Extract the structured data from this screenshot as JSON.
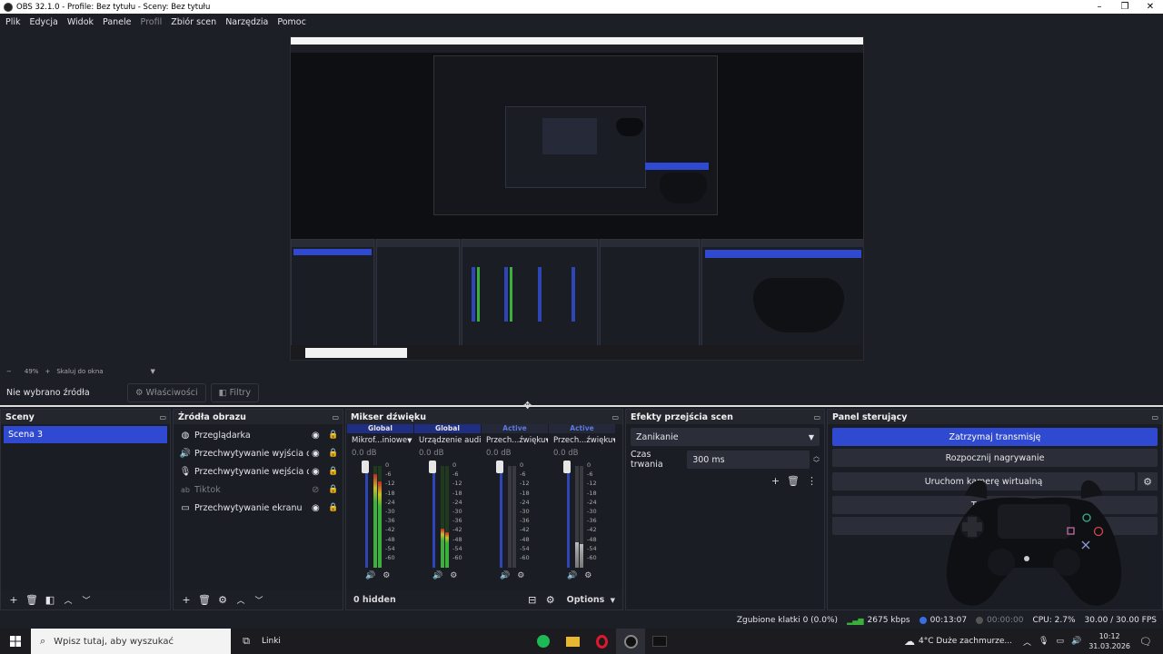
{
  "window": {
    "title": "OBS 32.1.0 - Profile: Bez tytułu - Sceny: Bez tytułu"
  },
  "menu": [
    {
      "label": "Plik",
      "enabled": true
    },
    {
      "label": "Edycja",
      "enabled": true
    },
    {
      "label": "Widok",
      "enabled": true
    },
    {
      "label": "Panele",
      "enabled": true
    },
    {
      "label": "Profil",
      "enabled": false
    },
    {
      "label": "Zbiór scen",
      "enabled": true
    },
    {
      "label": "Narzędzia",
      "enabled": true
    },
    {
      "label": "Pomoc",
      "enabled": true
    }
  ],
  "zoom": {
    "level": "49%",
    "mode": "Skaluj do okna"
  },
  "source_toolbar": {
    "no_source": "Nie wybrano źródła",
    "properties": "Właściwości",
    "filters": "Filtry"
  },
  "scenes": {
    "title": "Sceny",
    "items": [
      "Scena 3"
    ]
  },
  "sources": {
    "title": "Źródła obrazu",
    "items": [
      {
        "name": "Przeglądarka",
        "icon": "globe-icon",
        "visible": true
      },
      {
        "name": "Przechwytywanie wyjścia dźwięku",
        "icon": "speaker-icon",
        "visible": true
      },
      {
        "name": "Przechwytywanie wejścia dźwięku",
        "icon": "microphone-icon",
        "visible": true
      },
      {
        "name": "Tiktok",
        "icon": "text-icon",
        "visible": false
      },
      {
        "name": "Przechwytywanie ekranu",
        "icon": "monitor-icon",
        "visible": true
      }
    ]
  },
  "mixer": {
    "title": "Mikser dźwięku",
    "hidden_label": "0 hidden",
    "options_label": "Options",
    "scale": [
      "0",
      "-6",
      "-12",
      "-18",
      "-24",
      "-30",
      "-36",
      "-42",
      "-48",
      "-54",
      "-60"
    ],
    "channels": [
      {
        "status": "Global",
        "name": "Mikrof...iniowe",
        "db": "0.0 dB",
        "level": 0.92,
        "muted": false,
        "active": false
      },
      {
        "status": "Global",
        "name": "Urządzenie audio",
        "db": "0.0 dB",
        "level": 0.38,
        "muted": false,
        "active": false
      },
      {
        "status": "Active",
        "name": "Przech...źwięku",
        "db": "0.0 dB",
        "level": 0.0,
        "muted": true,
        "active": true
      },
      {
        "status": "Active",
        "name": "Przech...źwięku",
        "db": "0.0 dB",
        "level": 0.25,
        "muted": true,
        "active": true
      }
    ]
  },
  "transitions": {
    "title": "Efekty przejścia scen",
    "selected": "Zanikanie",
    "duration_label": "Czas trwania",
    "duration_value": "300 ms"
  },
  "controls": {
    "title": "Panel sterujący",
    "stop_stream": "Zatrzymaj transmisję",
    "start_record": "Rozpocznij nagrywanie",
    "virtual_cam": "Uruchom kamerę wirtualną",
    "studio_mode": "Tryb studia"
  },
  "status": {
    "dropped": "Zgubione klatki 0 (0.0%)",
    "bitrate": "2675 kbps",
    "stream_time": "00:13:07",
    "record_time": "00:00:00",
    "cpu": "CPU: 2.7%",
    "fps": "30.00 / 30.00 FPS"
  },
  "taskbar": {
    "search_placeholder": "Wpisz tutaj, aby wyszukać",
    "links": "Linki",
    "weather": "4°C  Duże zachmurze...",
    "time": "10:12",
    "date": "31.03.2026"
  },
  "colors": {
    "accent": "#2f4ad0",
    "background": "#1d1f26",
    "meter_green": "#3bb03b",
    "meter_yellow": "#c8c020",
    "meter_red": "#c02828"
  }
}
